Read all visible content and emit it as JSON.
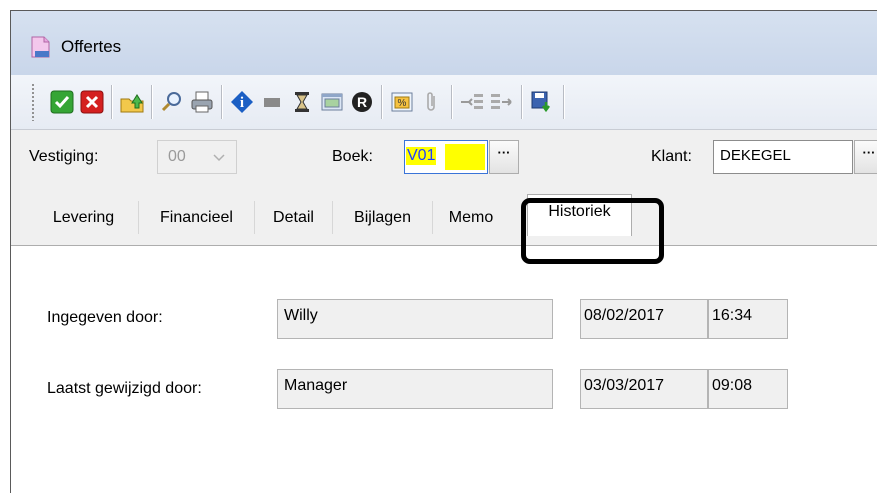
{
  "window": {
    "title": "Offertes"
  },
  "toolbar": {
    "buttons": [
      {
        "icon": "confirm-icon",
        "color": "#2e9b2e"
      },
      {
        "icon": "cancel-icon",
        "color": "#d42020"
      },
      {
        "icon": "export-folder-icon"
      },
      {
        "icon": "search-magnifier-icon"
      },
      {
        "icon": "print-icon"
      },
      {
        "icon": "info-icon",
        "color": "#1b5fc4"
      },
      {
        "icon": "stop-square-icon"
      },
      {
        "icon": "hourglass-icon"
      },
      {
        "icon": "image-window-icon"
      },
      {
        "icon": "registered-icon"
      },
      {
        "icon": "percent-icon"
      },
      {
        "icon": "paperclip-icon"
      },
      {
        "icon": "tree-split-icon"
      },
      {
        "icon": "tree-merge-icon"
      },
      {
        "icon": "save-download-icon"
      }
    ],
    "percent_glyph": "%",
    "registered_glyph": "R",
    "info_glyph": "i"
  },
  "header": {
    "vestiging_label": "Vestiging:",
    "vestiging_value": "00",
    "boek_label": "Boek:",
    "boek_value": "V01",
    "klant_label": "Klant:",
    "klant_value": "DEKEGEL",
    "lookup_button": "···"
  },
  "tabs": [
    "Levering",
    "Financieel",
    "Detail",
    "Bijlagen",
    "Memo",
    "Historiek"
  ],
  "active_tab": "Historiek",
  "historiek": {
    "entered_label": "Ingegeven door:",
    "entered_by": "Willy",
    "entered_date": "08/02/2017",
    "entered_time": "16:34",
    "modified_label": "Laatst gewijzigd door:",
    "modified_by": "Manager",
    "modified_date": "03/03/2017",
    "modified_time": "09:08"
  },
  "colors": {
    "selection_bg": "#ffff00",
    "selection_fg": "#1f3fff",
    "highlight_border": "#000000"
  }
}
